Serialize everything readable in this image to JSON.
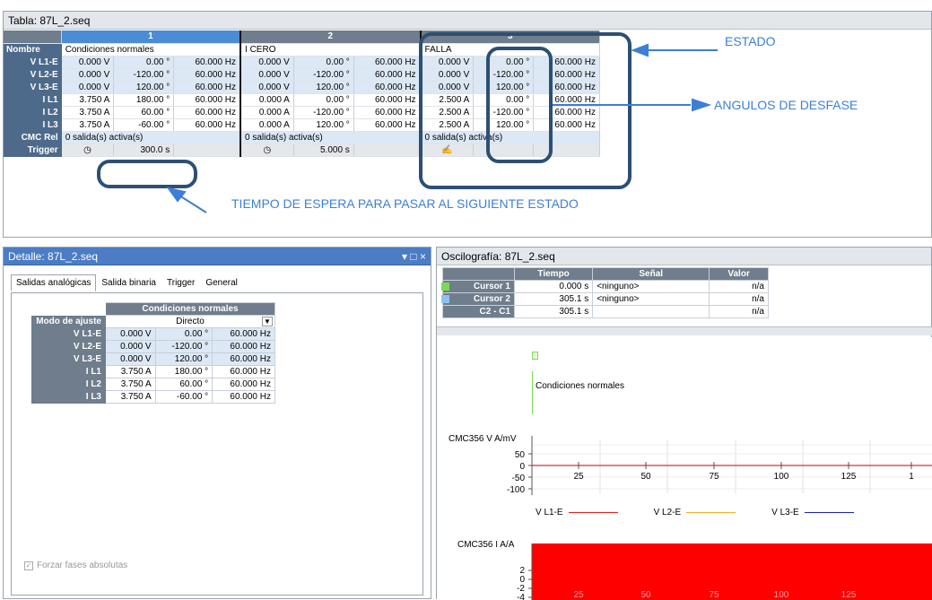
{
  "tabla": {
    "title": "Tabla: 87L_2.seq",
    "state_numbers": [
      "1",
      "2",
      "3"
    ],
    "row_headers": {
      "nombre": "Nombre",
      "rows": [
        "V L1-E",
        "V L2-E",
        "V L3-E",
        "I L1",
        "I L2",
        "I L3"
      ],
      "cmc": "CMC Rel",
      "trigger": "Trigger"
    },
    "states": [
      {
        "name": "Condiciones normales",
        "rows": [
          [
            "0.000 V",
            "0.00 °",
            "60.000 Hz"
          ],
          [
            "0.000 V",
            "-120.00 °",
            "60.000 Hz"
          ],
          [
            "0.000 V",
            "120.00 °",
            "60.000 Hz"
          ],
          [
            "3.750 A",
            "180.00 °",
            "60.000 Hz"
          ],
          [
            "3.750 A",
            "60.00 °",
            "60.000 Hz"
          ],
          [
            "3.750 A",
            "-60.00 °",
            "60.000 Hz"
          ]
        ],
        "cmc": "0 salida(s) activa(s)",
        "trigger_time": "300.0 s"
      },
      {
        "name": "I CERO",
        "rows": [
          [
            "0.000 V",
            "0.00 °",
            "60.000 Hz"
          ],
          [
            "0.000 V",
            "-120.00 °",
            "60.000 Hz"
          ],
          [
            "0.000 V",
            "120.00 °",
            "60.000 Hz"
          ],
          [
            "0.000 A",
            "0.00 °",
            "60.000 Hz"
          ],
          [
            "0.000 A",
            "-120.00 °",
            "60.000 Hz"
          ],
          [
            "0.000 A",
            "120.00 °",
            "60.000 Hz"
          ]
        ],
        "cmc": "0 salida(s) activa(s)",
        "trigger_time": "5.000 s"
      },
      {
        "name": "FALLA",
        "rows": [
          [
            "0.000 V",
            "0.00 °",
            "60.000 Hz"
          ],
          [
            "0.000 V",
            "-120.00 °",
            "60.000 Hz"
          ],
          [
            "0.000 V",
            "120.00 °",
            "60.000 Hz"
          ],
          [
            "2.500 A",
            "0.00 °",
            "60.000 Hz"
          ],
          [
            "2.500 A",
            "-120.00 °",
            "60.000 Hz"
          ],
          [
            "2.500 A",
            "120.00 °",
            "60.000 Hz"
          ]
        ],
        "cmc": "0 salida(s) activa(s)",
        "trigger_time": ""
      }
    ]
  },
  "annotations": {
    "estado": "ESTADO",
    "angulos": "ANGULOS  DE DESFASE",
    "tiempo": "TIEMPO DE ESPERA PARA PASAR AL SIGUIENTE ESTADO"
  },
  "detalle": {
    "title": "Detalle: 87L_2.seq",
    "window_controls": "▾ □ ×",
    "tabs": [
      "Salidas analógicas",
      "Salida binaria",
      "Trigger",
      "General"
    ],
    "state_header": "Condiciones normales",
    "modo_label": "Modo de ajuste",
    "modo_value": "Directo",
    "rows": [
      [
        "V L1-E",
        "0.000 V",
        "0.00 °",
        "60.000 Hz"
      ],
      [
        "V L2-E",
        "0.000 V",
        "-120.00 °",
        "60.000 Hz"
      ],
      [
        "V L3-E",
        "0.000 V",
        "120.00 °",
        "60.000 Hz"
      ],
      [
        "I L1",
        "3.750 A",
        "180.00 °",
        "60.000 Hz"
      ],
      [
        "I L2",
        "3.750 A",
        "60.00 °",
        "60.000 Hz"
      ],
      [
        "I L3",
        "3.750 A",
        "-60.00 °",
        "60.000 Hz"
      ]
    ],
    "forzar": "Forzar fases absolutas"
  },
  "osc": {
    "title": "Oscilografía: 87L_2.seq",
    "cursor_headers": [
      "Tiempo",
      "Señal",
      "Valor"
    ],
    "cursors": [
      {
        "name": "Cursor 1",
        "time": "0.000 s",
        "signal": "<ninguno>",
        "value": "n/a",
        "color": "#7ed957"
      },
      {
        "name": "Cursor 2",
        "time": "305.1 s",
        "signal": "<ninguno>",
        "value": "n/a",
        "color": "#8fc1ee"
      },
      {
        "name": "C2 - C1",
        "time": "305.1 s",
        "signal": "",
        "value": "n/a",
        "color": ""
      }
    ],
    "state_label": "Condiciones normales",
    "v_axis_title": "CMC356 V A/mV",
    "v_ticks": [
      "50",
      "0",
      "-50",
      "-100"
    ],
    "x_ticks": [
      "25",
      "50",
      "75",
      "100",
      "125",
      "1"
    ],
    "legend": [
      {
        "name": "V L1-E",
        "color": "#e02020"
      },
      {
        "name": "V L2-E",
        "color": "#f0b020"
      },
      {
        "name": "V L3-E",
        "color": "#2020c0"
      }
    ],
    "i_axis_title": "CMC356 I A/A",
    "i_ticks": [
      "2",
      "0",
      "-2",
      "-4"
    ],
    "i_fill_color": "#ff0000"
  }
}
